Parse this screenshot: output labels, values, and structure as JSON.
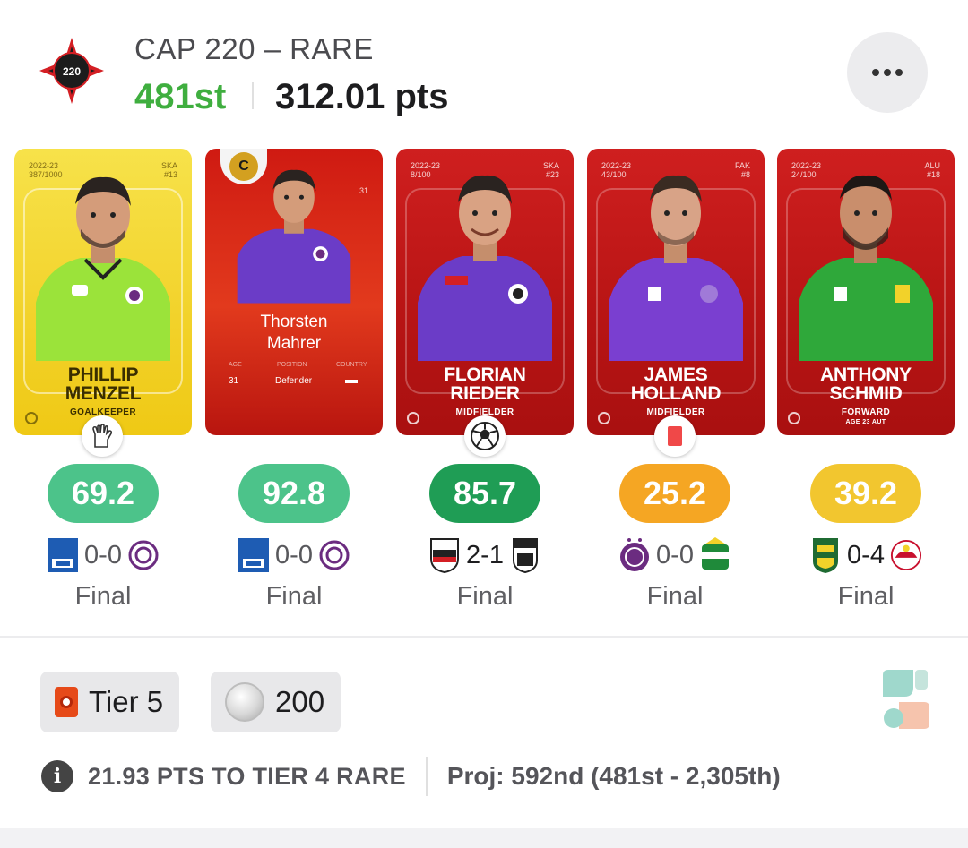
{
  "header": {
    "logo_text": "220",
    "title": "CAP 220 – RARE",
    "rank": "481st",
    "points": "312.01 pts"
  },
  "captain_badge": "C",
  "cards": [
    {
      "style": "gold",
      "serial": "2022-23\n387/1000",
      "club": "SKA\n#13",
      "name_line1": "PHILLIP",
      "name_line2": "MENZEL",
      "position": "GOALKEEPER",
      "shirt_color": "#9be33a",
      "stat_icon": "goalkeeper-glove-icon",
      "score": "69.2",
      "score_color": "#4cc38a",
      "home_score": "0-0",
      "status": "Final",
      "home_badge": "blau-weiss-linz-badge",
      "away_badge": "austria-klagenfurt-badge"
    },
    {
      "style": "orange",
      "serial": "",
      "club": "31",
      "name_line1": "Thorsten",
      "name_line2": "Mahrer",
      "position": "",
      "stats": {
        "age_label": "AGE",
        "age": "31",
        "position_label": "POSITION",
        "position": "Defender",
        "country_label": "COUNTRY"
      },
      "shirt_color": "#6b3cc7",
      "score": "92.8",
      "score_color": "#4cc38a",
      "home_score": "0-0",
      "status": "Final",
      "home_badge": "blau-weiss-linz-badge",
      "away_badge": "austria-klagenfurt-badge"
    },
    {
      "style": "red",
      "serial": "2022-23\n8/100",
      "club": "SKA\n#23",
      "name_line1": "FLORIAN",
      "name_line2": "RIEDER",
      "position": "MIDFIELDER",
      "shirt_color": "#6b3cc7",
      "stat_icon": "soccer-ball-icon",
      "score": "85.7",
      "score_color": "#1f9d55",
      "home_score": "2-1",
      "status": "Final",
      "home_badge": "wolfsberger-ac-badge",
      "away_badge": "lask-badge"
    },
    {
      "style": "red",
      "serial": "2022-23\n43/100",
      "club": "FAK\n#8",
      "name_line1": "JAMES",
      "name_line2": "HOLLAND",
      "position": "MIDFIELDER",
      "shirt_color": "#7a3fd0",
      "stat_icon": "red-card-icon",
      "score": "25.2",
      "score_color": "#f5a623",
      "home_score": "0-0",
      "status": "Final",
      "home_badge": "austria-wien-badge",
      "away_badge": "rapid-wien-badge"
    },
    {
      "style": "red",
      "serial": "2022-23\n24/100",
      "club": "ALU\n#18",
      "name_line1": "ANTHONY",
      "name_line2": "SCHMID",
      "position": "FORWARD",
      "position_sub": "AGE 23 AUT",
      "shirt_color": "#2fa83a",
      "score": "39.2",
      "score_color": "#f2c62f",
      "home_score": "0-4",
      "status": "Final",
      "home_badge": "austria-lustenau-badge",
      "away_badge": "red-bull-salzburg-badge"
    }
  ],
  "rewards": {
    "tier_label": "Tier 5",
    "coins": "200"
  },
  "info": {
    "icon_glyph": "i",
    "pts_to_tier": "21.93 PTS TO TIER 4 RARE",
    "projection": "Proj: 592nd (481st - 2,305th)"
  }
}
